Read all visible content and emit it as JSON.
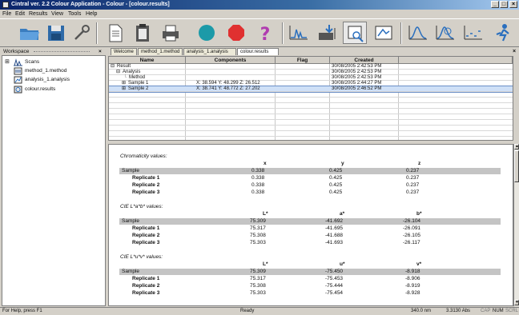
{
  "window": {
    "title": "Cintral ver. 2.2 Colour Application - Colour - [colour.results]",
    "controls": [
      "_",
      "□",
      "×"
    ]
  },
  "menu": [
    "File",
    "Edit",
    "Results",
    "View",
    "Tools",
    "Help"
  ],
  "toolbar": [
    "open-folder-icon",
    "save-disk-icon",
    "wrench-icon",
    "new-document-icon",
    "paste-icon",
    "print-icon",
    "cyan-circle-icon",
    "red-stop-icon",
    "help-question-icon",
    "peak-chart-icon",
    "export-data-icon",
    "select-view-icon",
    "zoom-window-icon",
    "spectrum-icon",
    "spectrum-marker-icon",
    "dotted-chart-icon",
    "run-icon"
  ],
  "workspace": {
    "title": "Workspace",
    "close": "×",
    "items": [
      {
        "label": "Scans",
        "icon": "scans-icon",
        "expander": "⊞"
      },
      {
        "label": "method_1.method",
        "icon": "method-icon"
      },
      {
        "label": "analysis_1.analysis",
        "icon": "analysis-icon"
      },
      {
        "label": "colour.results",
        "icon": "results-icon"
      }
    ]
  },
  "tabs": [
    "Welcome",
    "method_1.method",
    "analysis_1.analysis",
    "colour.results"
  ],
  "tab_close": "×",
  "results_table": {
    "columns": [
      "Name",
      "Components",
      "Flag",
      "Created"
    ],
    "rows": [
      {
        "name": "Result",
        "expander": "⊟",
        "components": "",
        "flag": "",
        "created": "30/08/2005 2:42:53 PM"
      },
      {
        "name": "Analysis",
        "expander": "⊟",
        "components": "",
        "flag": "",
        "created": "30/08/2005 2:42:53 PM"
      },
      {
        "name": "Method",
        "expander": "",
        "components": "",
        "flag": "",
        "created": "30/08/2005 2:42:53 PM"
      },
      {
        "name": "Sample 1",
        "expander": "⊞",
        "components": "X: 38.594  Y: 48.299  Z: 26.512",
        "flag": "",
        "created": "30/08/2005 2:44:27 PM"
      },
      {
        "name": "Sample 2",
        "expander": "⊞",
        "components": "X: 38.741  Y: 48.772  Z: 27.202",
        "flag": "",
        "created": "30/08/2005 2:46:52 PM"
      }
    ]
  },
  "report": {
    "sections": [
      {
        "title": "Chromaticity values:",
        "headers": [
          "x",
          "y",
          "z"
        ],
        "rows": [
          {
            "label": "Sample",
            "values": [
              "0.338",
              "0.425",
              "0.237"
            ],
            "highlight": true
          },
          {
            "label": "Replicate 1",
            "values": [
              "0.338",
              "0.425",
              "0.237"
            ]
          },
          {
            "label": "Replicate 2",
            "values": [
              "0.338",
              "0.425",
              "0.237"
            ]
          },
          {
            "label": "Replicate 3",
            "values": [
              "0.338",
              "0.425",
              "0.237"
            ]
          }
        ]
      },
      {
        "title": "CIE L*a*b* values:",
        "headers": [
          "L*",
          "a*",
          "b*"
        ],
        "rows": [
          {
            "label": "Sample",
            "values": [
              "75.309",
              "-41.692",
              "-26.104"
            ],
            "highlight": true
          },
          {
            "label": "Replicate 1",
            "values": [
              "75.317",
              "-41.695",
              "-26.091"
            ]
          },
          {
            "label": "Replicate 2",
            "values": [
              "75.308",
              "-41.688",
              "-26.105"
            ]
          },
          {
            "label": "Replicate 3",
            "values": [
              "75.303",
              "-41.693",
              "-26.117"
            ]
          }
        ]
      },
      {
        "title": "CIE L*u*v* values:",
        "headers": [
          "L*",
          "u*",
          "v*"
        ],
        "rows": [
          {
            "label": "Sample",
            "values": [
              "75.309",
              "-75.450",
              "-8.918"
            ],
            "highlight": true
          },
          {
            "label": "Replicate 1",
            "values": [
              "75.317",
              "-75.453",
              "-8.906"
            ]
          },
          {
            "label": "Replicate 2",
            "values": [
              "75.308",
              "-75.444",
              "-8.919"
            ]
          },
          {
            "label": "Replicate 3",
            "values": [
              "75.303",
              "-75.454",
              "-8.928"
            ]
          }
        ]
      }
    ]
  },
  "statusbar": {
    "help": "For Help, press F1",
    "state": "Ready",
    "wavelength": "340.0 nm",
    "absorbance": "3.3130 Abs",
    "indicators": [
      "CAP",
      "NUM",
      "SCRL"
    ]
  },
  "colors": {
    "titlebar": "#0a246a",
    "selection": "#cfe0f7",
    "chrome": "#d4d0c8"
  }
}
